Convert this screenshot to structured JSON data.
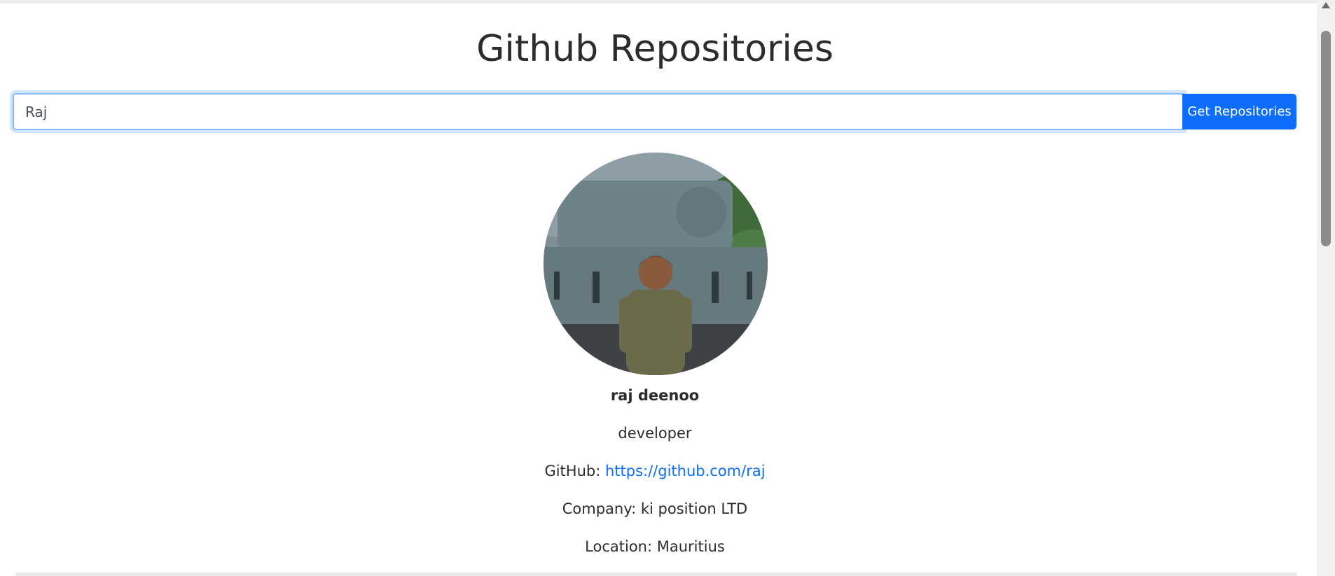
{
  "header": {
    "title": "Github Repositories"
  },
  "search": {
    "value": "Raj",
    "button_label": "Get Repositories"
  },
  "profile": {
    "name": "raj deenoo",
    "bio": "developer",
    "github_label": "GitHub:",
    "github_url": "https://github.com/raj",
    "company_label": "Company:",
    "company": "ki position LTD",
    "location_label": "Location:",
    "location": "Mauritius"
  },
  "colors": {
    "accent": "#0d6efd",
    "focus_border": "#86b7fe"
  }
}
